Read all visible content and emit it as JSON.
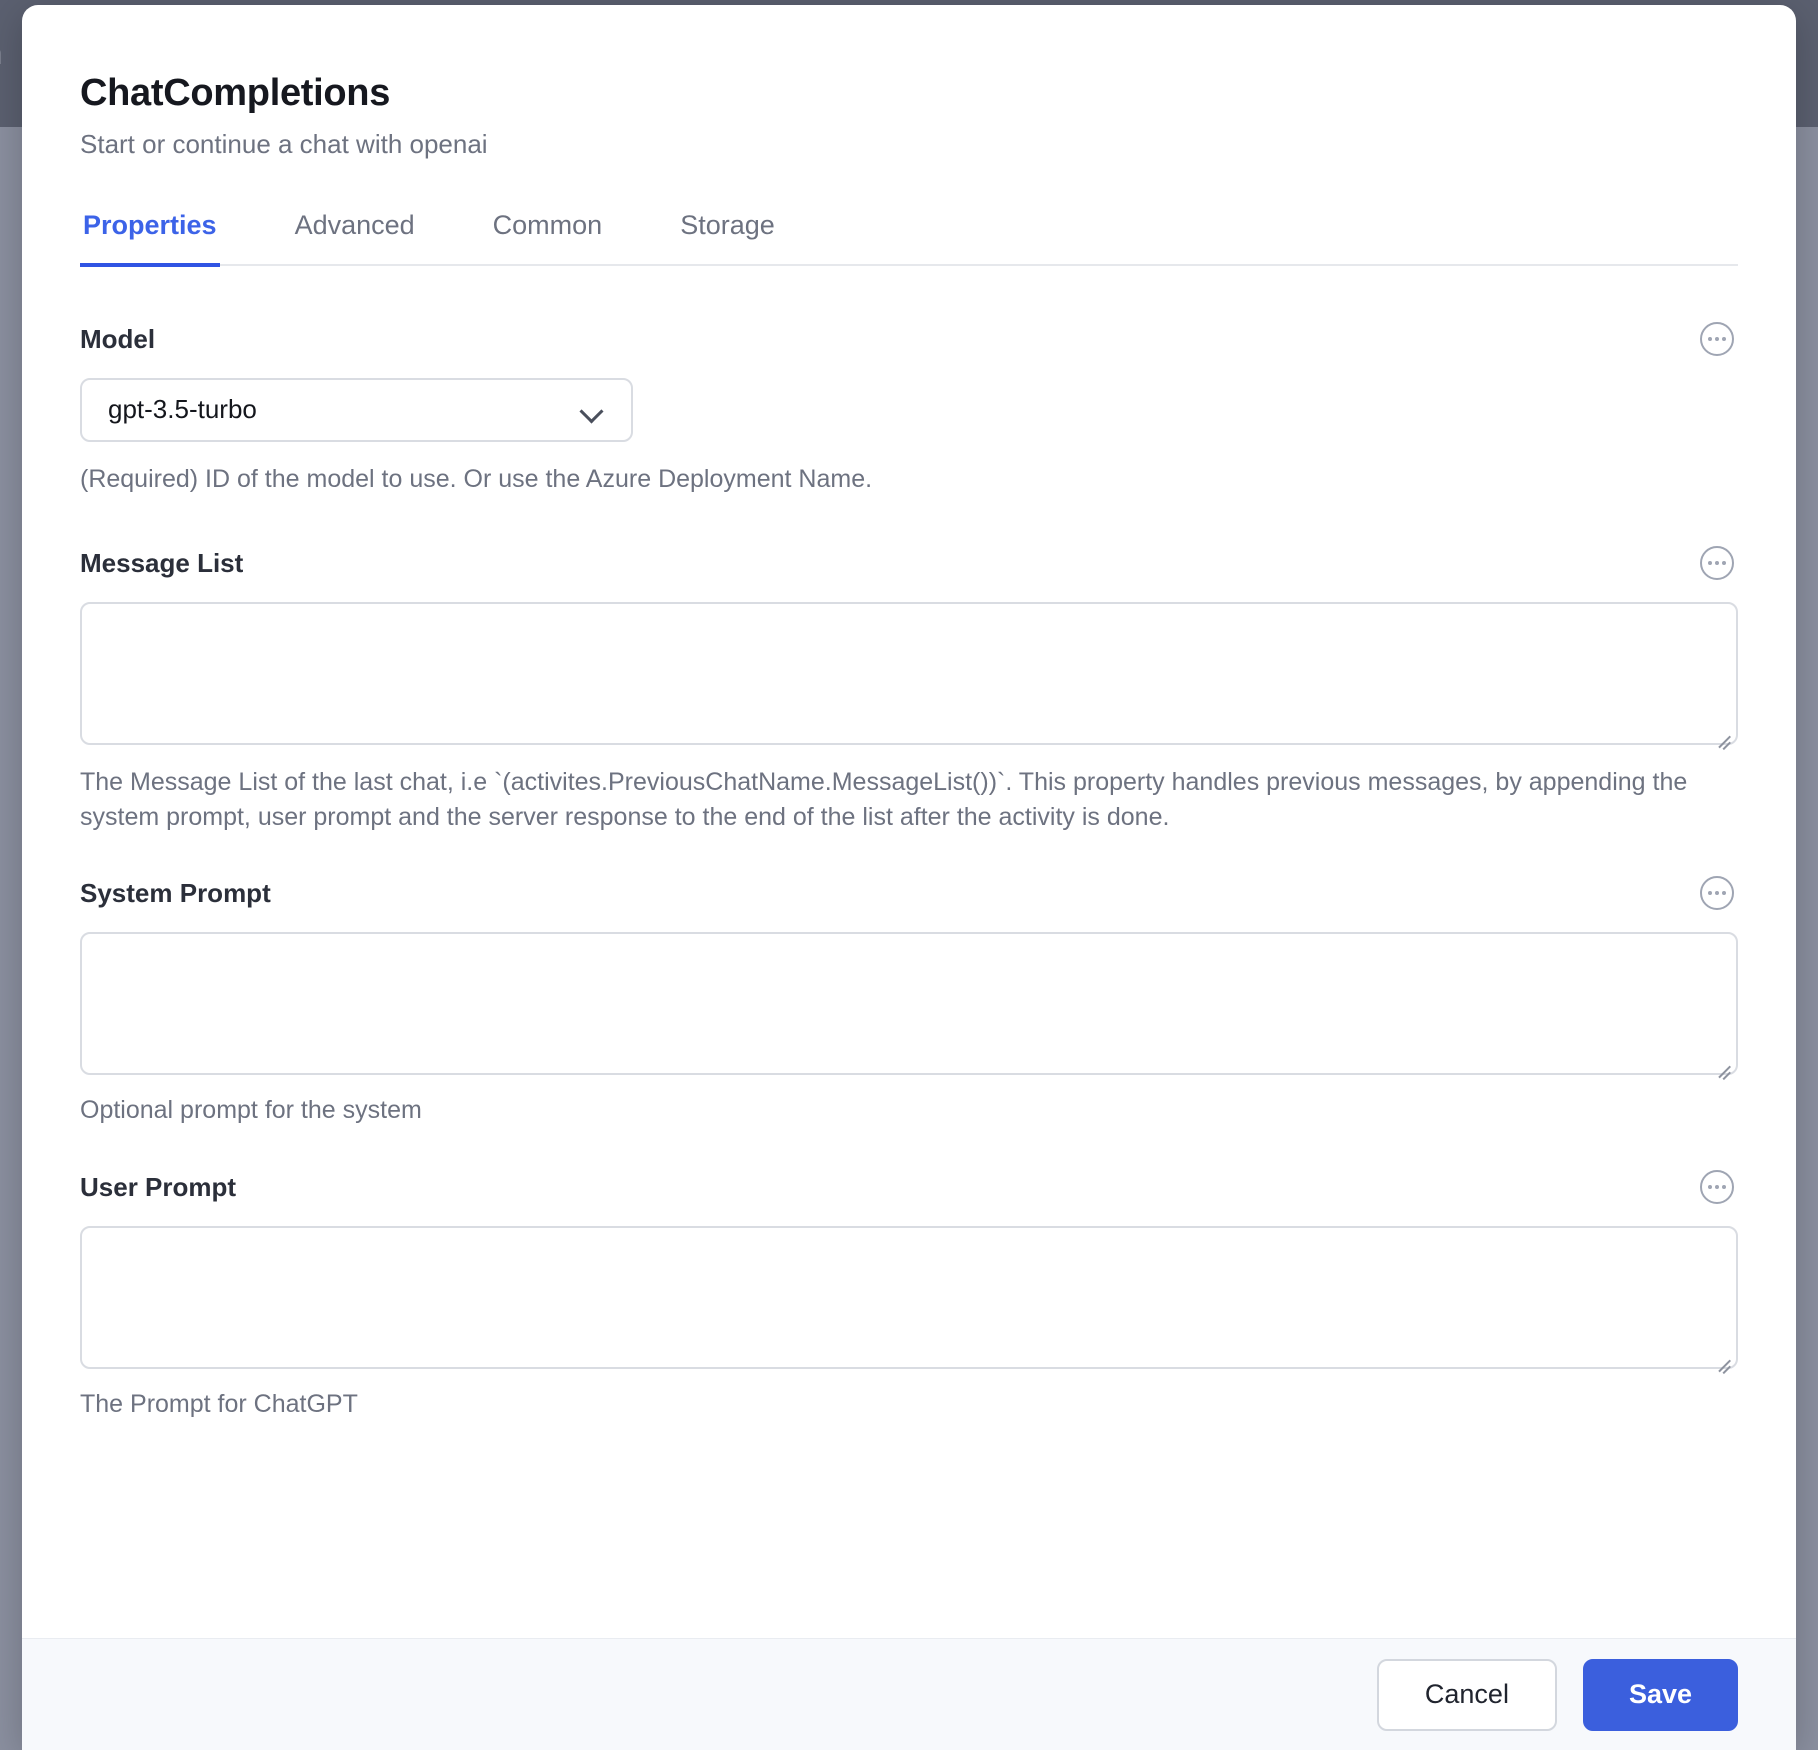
{
  "backdrop": {
    "fragment_text": "n"
  },
  "dialog": {
    "title": "ChatCompletions",
    "subtitle": "Start or continue a chat with openai"
  },
  "tabs": [
    {
      "label": "Properties",
      "active": true
    },
    {
      "label": "Advanced",
      "active": false
    },
    {
      "label": "Common",
      "active": false
    },
    {
      "label": "Storage",
      "active": false
    }
  ],
  "fields": {
    "model": {
      "label": "Model",
      "value": "gpt-3.5-turbo",
      "help": "(Required) ID of the model to use. Or use the Azure Deployment Name.",
      "menu_icon": "ellipsis-circle-icon"
    },
    "message_list": {
      "label": "Message List",
      "value": "",
      "placeholder": "",
      "help": "The Message List of the last chat, i.e `(activites.PreviousChatName.MessageList())`. This property handles previous messages, by appending the system prompt, user prompt and the server response to the end of the list after the activity is done.",
      "menu_icon": "ellipsis-circle-icon"
    },
    "system_prompt": {
      "label": "System Prompt",
      "value": "",
      "placeholder": "",
      "help": "Optional prompt for the system",
      "menu_icon": "ellipsis-circle-icon"
    },
    "user_prompt": {
      "label": "User Prompt",
      "value": "",
      "placeholder": "",
      "help": "The Prompt for ChatGPT",
      "menu_icon": "ellipsis-circle-icon"
    }
  },
  "footer": {
    "cancel_label": "Cancel",
    "save_label": "Save"
  },
  "colors": {
    "accent": "#3b5fdd",
    "tab_active": "#3c63e8",
    "label": "#2b2f3a",
    "help": "#6d7280",
    "border": "#d9dce2",
    "footer_bg": "#f7f9fc",
    "backdrop": "#5b6070"
  }
}
